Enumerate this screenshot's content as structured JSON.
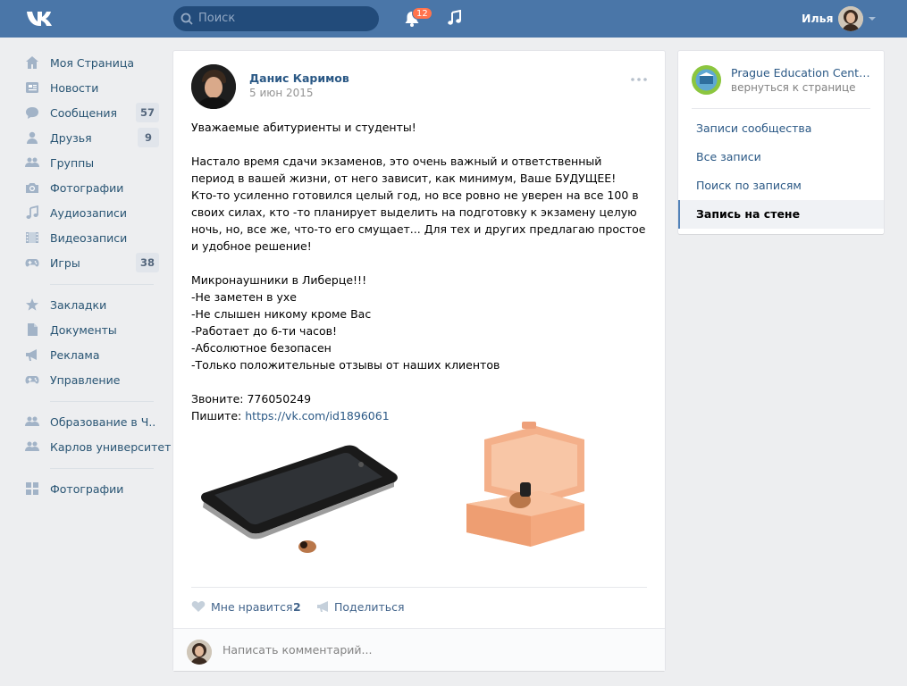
{
  "header": {
    "search_placeholder": "Поиск",
    "notifications_count": "12",
    "user_name": "Илья"
  },
  "left_menu": {
    "items": [
      {
        "label": "Моя Страница",
        "icon": "home-icon"
      },
      {
        "label": "Новости",
        "icon": "news-icon"
      },
      {
        "label": "Сообщения",
        "icon": "messages-icon",
        "count": "57"
      },
      {
        "label": "Друзья",
        "icon": "friends-icon",
        "count": "9"
      },
      {
        "label": "Группы",
        "icon": "groups-icon"
      },
      {
        "label": "Фотографии",
        "icon": "camera-icon"
      },
      {
        "label": "Аудиозаписи",
        "icon": "music-icon"
      },
      {
        "label": "Видеозаписи",
        "icon": "video-icon"
      },
      {
        "label": "Игры",
        "icon": "gamepad-icon",
        "count": "38"
      },
      {
        "label": "Закладки",
        "icon": "star-icon"
      },
      {
        "label": "Документы",
        "icon": "document-icon"
      },
      {
        "label": "Реклама",
        "icon": "megaphone-icon"
      },
      {
        "label": "Управление",
        "icon": "gamepad-icon"
      },
      {
        "label": "Образование в Ч..",
        "icon": "groups-icon"
      },
      {
        "label": "Карлов университет",
        "icon": "groups-icon"
      },
      {
        "label": "Фотографии",
        "icon": "apps-icon"
      }
    ]
  },
  "post": {
    "author": "Данис Каримов",
    "date": "5 июн 2015",
    "text": [
      "Уважаемые абитуриенты и студенты!",
      "",
      "Настало время сдачи экзаменов, это очень важный и ответственный период в вашей жизни, от него зависит, как минимум, Ваше БУДУЩЕЕ!",
      "Кто-то усиленно готовился целый год, но все ровно не уверен на все 100 в своих силах, кто -то планирует выделить на подготовку к экзамену целую ночь, но, все же, что-то его смущает... Для тех и других предлагаю простое и удобное решение!",
      "",
      "Микронаушники в Либерце!!!",
      "-Не заметен в ухе",
      "-Не слышен никому кроме Вас",
      "-Работает до 6-ти часов!",
      "-Абсолютное безопасен",
      "-Только положительные отзывы от наших клиентов",
      "",
      "Звоните: 776050249"
    ],
    "write_label": "Пишите: ",
    "link": "https://vk.com/id1896061",
    "like_label": "Мне нравится",
    "like_count": "2",
    "share_label": "Поделиться",
    "comment_placeholder": "Написать комментарий..."
  },
  "right_panel": {
    "group_name": "Prague Education Center - ...",
    "back_label": "вернуться к странице",
    "links": [
      {
        "label": "Записи сообщества",
        "active": false
      },
      {
        "label": "Все записи",
        "active": false
      },
      {
        "label": "Поиск по записям",
        "active": false
      },
      {
        "label": "Запись на стене",
        "active": true
      }
    ]
  },
  "colors": {
    "header_bg": "#4a76a8",
    "link": "#2a5885",
    "menu_text": "#285473",
    "badge": "#ff734c"
  }
}
